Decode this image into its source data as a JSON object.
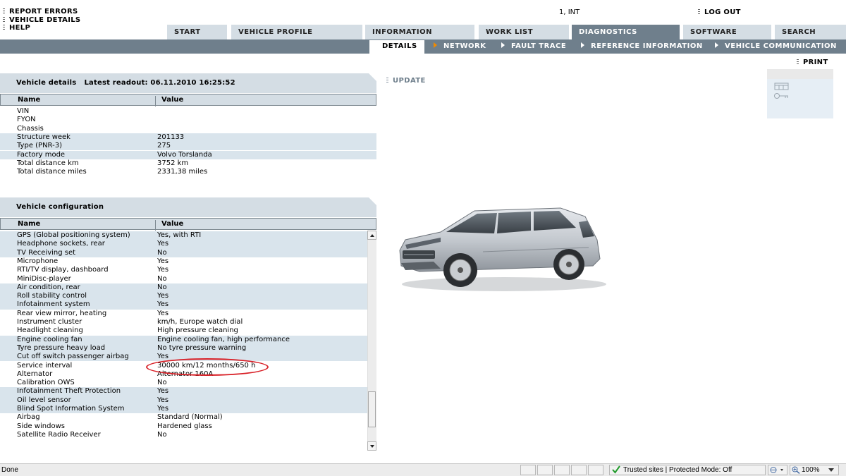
{
  "top_links": [
    "REPORT ERRORS",
    "VEHICLE DETAILS",
    "HELP"
  ],
  "user": "1, INT",
  "logout_label": "LOG OUT",
  "tabs": [
    {
      "label": "START"
    },
    {
      "label": "VEHICLE PROFILE"
    },
    {
      "label": "INFORMATION"
    },
    {
      "label": "WORK LIST"
    },
    {
      "label": "DIAGNOSTICS"
    },
    {
      "label": "SOFTWARE"
    },
    {
      "label": "SEARCH"
    }
  ],
  "subtabs": [
    {
      "label": "DETAILS"
    },
    {
      "label": "NETWORK"
    },
    {
      "label": "FAULT TRACE"
    },
    {
      "label": "REFERENCE INFORMATION"
    },
    {
      "label": "VEHICLE COMMUNICATION"
    }
  ],
  "print_label": "PRINT",
  "update_label": "UPDATE",
  "vehicle_details": {
    "title": "Vehicle details",
    "readout": "Latest readout: 06.11.2010 16:25:52",
    "col_name": "Name",
    "col_value": "Value",
    "rows": [
      {
        "name": "VIN",
        "value": ""
      },
      {
        "name": "FYON",
        "value": ""
      },
      {
        "name": "Chassis",
        "value": ""
      },
      {
        "name": "Structure week",
        "value": "201133"
      },
      {
        "name": "Type (PNR-3)",
        "value": "275"
      },
      {
        "name": "Factory mode",
        "value": "Volvo Torslanda"
      },
      {
        "name": "Total distance km",
        "value": "3752 km"
      },
      {
        "name": "Total distance miles",
        "value": "2331,38 miles"
      }
    ]
  },
  "vehicle_config": {
    "title": "Vehicle configuration",
    "col_name": "Name",
    "col_value": "Value",
    "rows": [
      {
        "name": "GPS (Global positioning system)",
        "value": "Yes, with RTI"
      },
      {
        "name": "Headphone sockets, rear",
        "value": "Yes"
      },
      {
        "name": "TV Receiving set",
        "value": "No"
      },
      {
        "name": "Microphone",
        "value": "Yes"
      },
      {
        "name": "RTI/TV display, dashboard",
        "value": "Yes"
      },
      {
        "name": "MiniDisc-player",
        "value": "No"
      },
      {
        "name": "Air condition, rear",
        "value": "No"
      },
      {
        "name": "Roll stability control",
        "value": "Yes"
      },
      {
        "name": "Infotainment system",
        "value": "Yes"
      },
      {
        "name": "Rear view mirror, heating",
        "value": "Yes"
      },
      {
        "name": "Instrument cluster",
        "value": "km/h, Europe watch dial"
      },
      {
        "name": "Headlight cleaning",
        "value": "High pressure cleaning"
      },
      {
        "name": "Engine cooling fan",
        "value": "Engine cooling fan, high performance"
      },
      {
        "name": "Tyre pressure heavy load",
        "value": "No tyre pressure warning"
      },
      {
        "name": "Cut off switch passenger airbag",
        "value": "Yes"
      },
      {
        "name": "Service interval",
        "value": "30000 km/12 months/650 h"
      },
      {
        "name": "Alternator",
        "value": "Alternator 160A"
      },
      {
        "name": "Calibration OWS",
        "value": "No"
      },
      {
        "name": "Infotainment Theft Protection",
        "value": "Yes"
      },
      {
        "name": "Oil level sensor",
        "value": "Yes"
      },
      {
        "name": "Blind Spot Information System",
        "value": "Yes"
      },
      {
        "name": "Airbag",
        "value": "Standard (Normal)"
      },
      {
        "name": "Side windows",
        "value": "Hardened glass"
      },
      {
        "name": "Satellite Radio Receiver",
        "value": "No"
      }
    ]
  },
  "statusbar": {
    "status": "Done",
    "zone": "Trusted sites | Protected Mode: Off",
    "zoom": "100%"
  },
  "colors": {
    "tab_bg": "#d4dde4",
    "tab_active": "#6f7f8c",
    "row_alt": "#d9e4ec",
    "highlight": "#d81f26",
    "arrow_accent": "#f08a00"
  }
}
